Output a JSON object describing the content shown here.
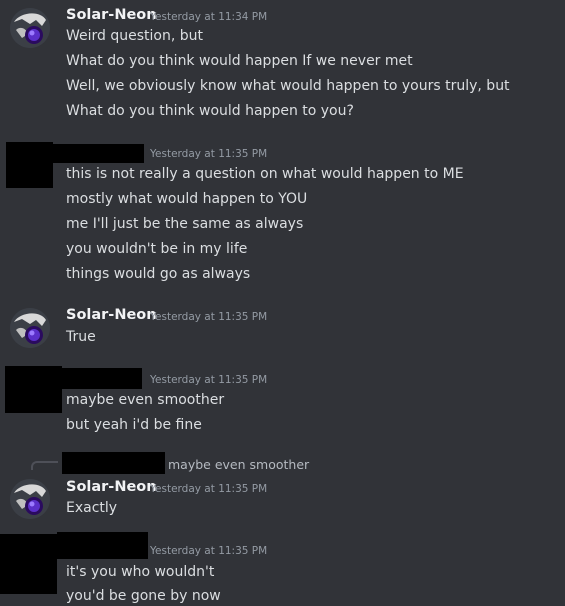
{
  "messages": [
    {
      "author": "Solar-Neon",
      "timestamp": "Yesterday at 11:34 PM",
      "lines": [
        "Weird question, but",
        "What do you think would happen If we never met",
        "Well, we obviously know what would happen to yours truly, but",
        "What do you think would happen to you?"
      ]
    },
    {
      "author": "",
      "timestamp": "Yesterday at 11:35 PM",
      "lines": [
        "this is not really a question on what would happen to ME",
        "mostly what would happen to YOU",
        "me I'll just be the same as always",
        "you wouldn't be in my life",
        "things would go as always"
      ]
    },
    {
      "author": "Solar-Neon",
      "timestamp": "Yesterday at 11:35 PM",
      "lines": [
        "True"
      ]
    },
    {
      "author": "",
      "timestamp": "Yesterday at 11:35 PM",
      "lines": [
        "maybe even smoother",
        "but yeah i'd be fine"
      ]
    },
    {
      "author": "Solar-Neon",
      "timestamp": "Yesterday at 11:35 PM",
      "reply_preview": "maybe even smoother",
      "lines": [
        "Exactly"
      ]
    },
    {
      "author": "",
      "timestamp": "Yesterday at 11:35 PM",
      "lines": [
        "it's you who wouldn't",
        "you'd be gone by now"
      ]
    }
  ],
  "colors": {
    "background": "#313338",
    "text": "#dbdee1",
    "username": "#f2f3f5",
    "timestamp": "#949ba4",
    "redaction": "#000000"
  }
}
